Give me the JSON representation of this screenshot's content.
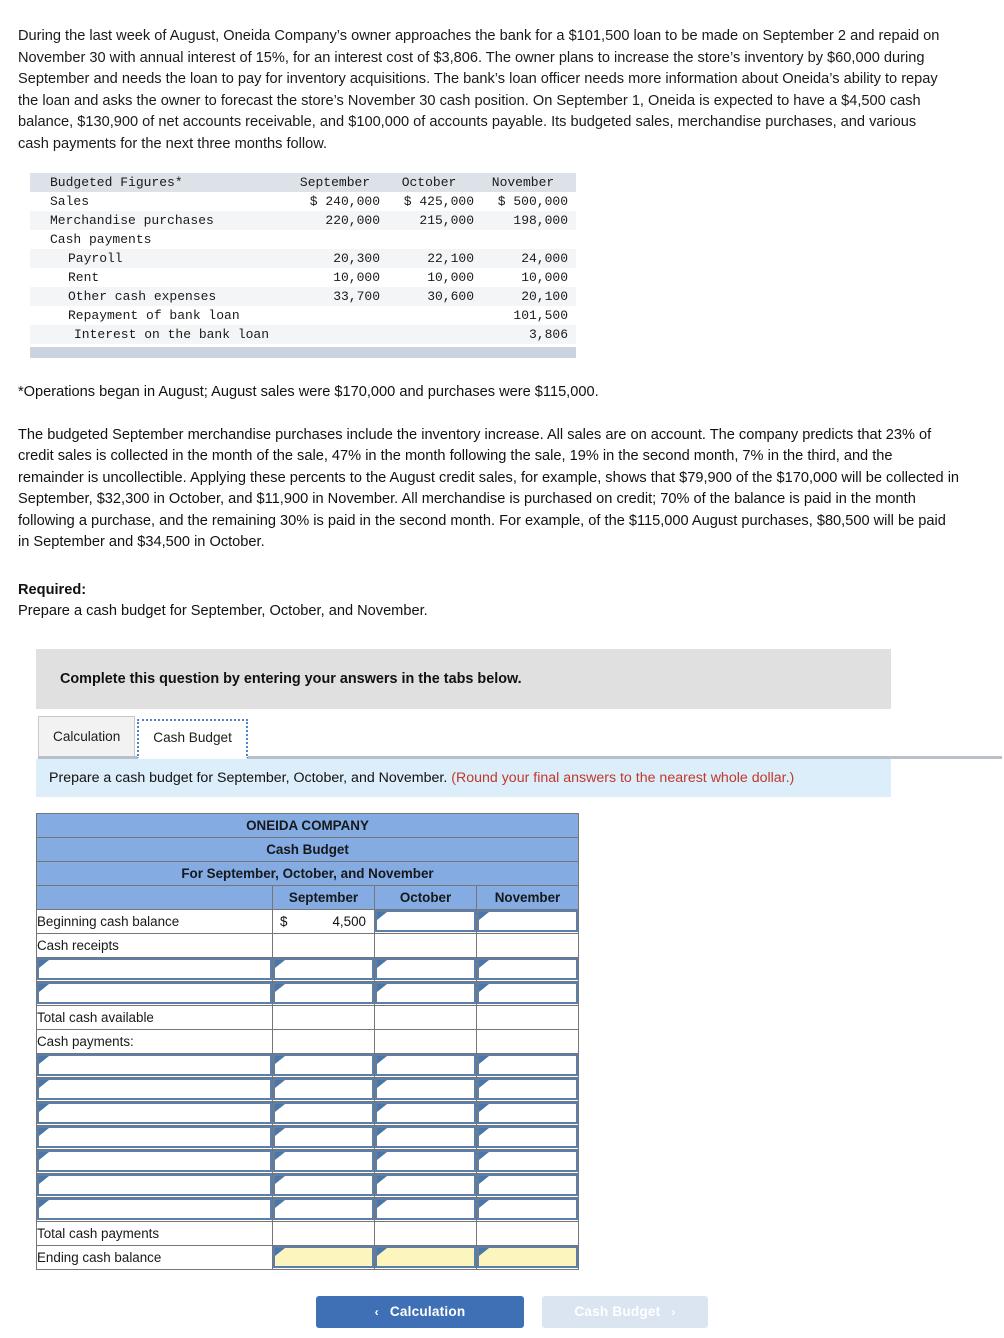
{
  "intro": "During the last week of August, Oneida Company’s owner approaches the bank for a $101,500 loan to be made on September 2 and repaid on November 30 with annual interest of 15%, for an interest cost of $3,806. The owner plans to increase the store’s inventory by $60,000 during September and needs the loan to pay for inventory acquisitions. The bank’s loan officer needs more information about Oneida’s ability to repay the loan and asks the owner to forecast the store’s November 30 cash position. On September 1, Oneida is expected to have a $4,500 cash balance, $130,900 of net accounts receivable, and $100,000 of accounts payable. Its budgeted sales, merchandise purchases, and various cash payments for the next three months follow.",
  "budgeted_figures": {
    "title": "Budgeted Figures*",
    "columns": [
      "September",
      "October",
      "November"
    ],
    "rows": [
      {
        "label": "Sales",
        "indent": 0,
        "values": [
          "$ 240,000",
          "$ 425,000",
          "$ 500,000"
        ]
      },
      {
        "label": "Merchandise purchases",
        "indent": 0,
        "values": [
          "220,000",
          "215,000",
          "198,000"
        ]
      },
      {
        "label": "Cash payments",
        "indent": 0,
        "values": [
          "",
          "",
          ""
        ]
      },
      {
        "label": "Payroll",
        "indent": 1,
        "values": [
          "20,300",
          "22,100",
          "24,000"
        ]
      },
      {
        "label": "Rent",
        "indent": 1,
        "values": [
          "10,000",
          "10,000",
          "10,000"
        ]
      },
      {
        "label": "Other cash expenses",
        "indent": 1,
        "values": [
          "33,700",
          "30,600",
          "20,100"
        ]
      },
      {
        "label": "Repayment of bank loan",
        "indent": 1,
        "values": [
          "",
          "",
          "101,500"
        ]
      },
      {
        "label": "Interest on the bank loan",
        "indent": 2,
        "values": [
          "",
          "",
          "3,806"
        ]
      }
    ]
  },
  "footnote": "*Operations began in August; August sales were $170,000 and purchases were $115,000.",
  "explanation": "The budgeted September merchandise purchases include the inventory increase. All sales are on account. The company predicts that 23% of credit sales is collected in the month of the sale, 47% in the month following the sale, 19% in the second month, 7% in the third, and the remainder is uncollectible. Applying these percents to the August credit sales, for example, shows that $79,900 of the $170,000 will be collected in September, $32,300 in October, and $11,900 in November. All merchandise is purchased on credit; 70% of the balance is paid in the month following a purchase, and the remaining 30% is paid in the second month. For example, of the $115,000 August purchases, $80,500 will be paid in September and $34,500 in October.",
  "required": {
    "heading": "Required:",
    "text": "Prepare a cash budget for September, October, and November."
  },
  "banner": "Complete this question by entering your answers in the tabs below.",
  "tabs": [
    {
      "label": "Calculation",
      "active": false
    },
    {
      "label": "Cash Budget",
      "active": true
    }
  ],
  "instruction": {
    "text": "Prepare a cash budget for September, October, and November.",
    "hint": "(Round your final answers to the nearest whole dollar.)"
  },
  "cash_budget": {
    "title1": "ONEIDA COMPANY",
    "title2": "Cash Budget",
    "title3": "For September, October, and November",
    "columns": [
      "September",
      "October",
      "November"
    ],
    "rows": [
      {
        "label": "Beginning cash balance",
        "type": "mixed",
        "sep_currency": "$",
        "sep_value": "4,500"
      },
      {
        "label": "Cash receipts",
        "type": "static"
      },
      {
        "label": "",
        "type": "input"
      },
      {
        "label": "",
        "type": "input",
        "close_section": true
      },
      {
        "label": "Total cash available",
        "type": "total"
      },
      {
        "label": "Cash payments:",
        "type": "static"
      },
      {
        "label": "",
        "type": "input"
      },
      {
        "label": "",
        "type": "input"
      },
      {
        "label": "",
        "type": "input"
      },
      {
        "label": "",
        "type": "input"
      },
      {
        "label": "",
        "type": "input"
      },
      {
        "label": "",
        "type": "input"
      },
      {
        "label": "",
        "type": "input",
        "close_section": true
      },
      {
        "label": "Total cash payments",
        "type": "total"
      },
      {
        "label": "Ending cash balance",
        "type": "input-yellow"
      }
    ]
  },
  "nav": {
    "prev_label": "Calculation",
    "next_label": "Cash Budget",
    "prev_chevron": "‹",
    "next_chevron": "›"
  },
  "colors": {
    "header_blue": "#84ace2",
    "input_border": "#5b7fa8",
    "highlight_yellow": "#fcf5be",
    "banner_grey": "#e0e0e0",
    "instruction_blue": "#ddeefb",
    "button_blue": "#3f6fb5",
    "hint_red": "#c0392b"
  }
}
